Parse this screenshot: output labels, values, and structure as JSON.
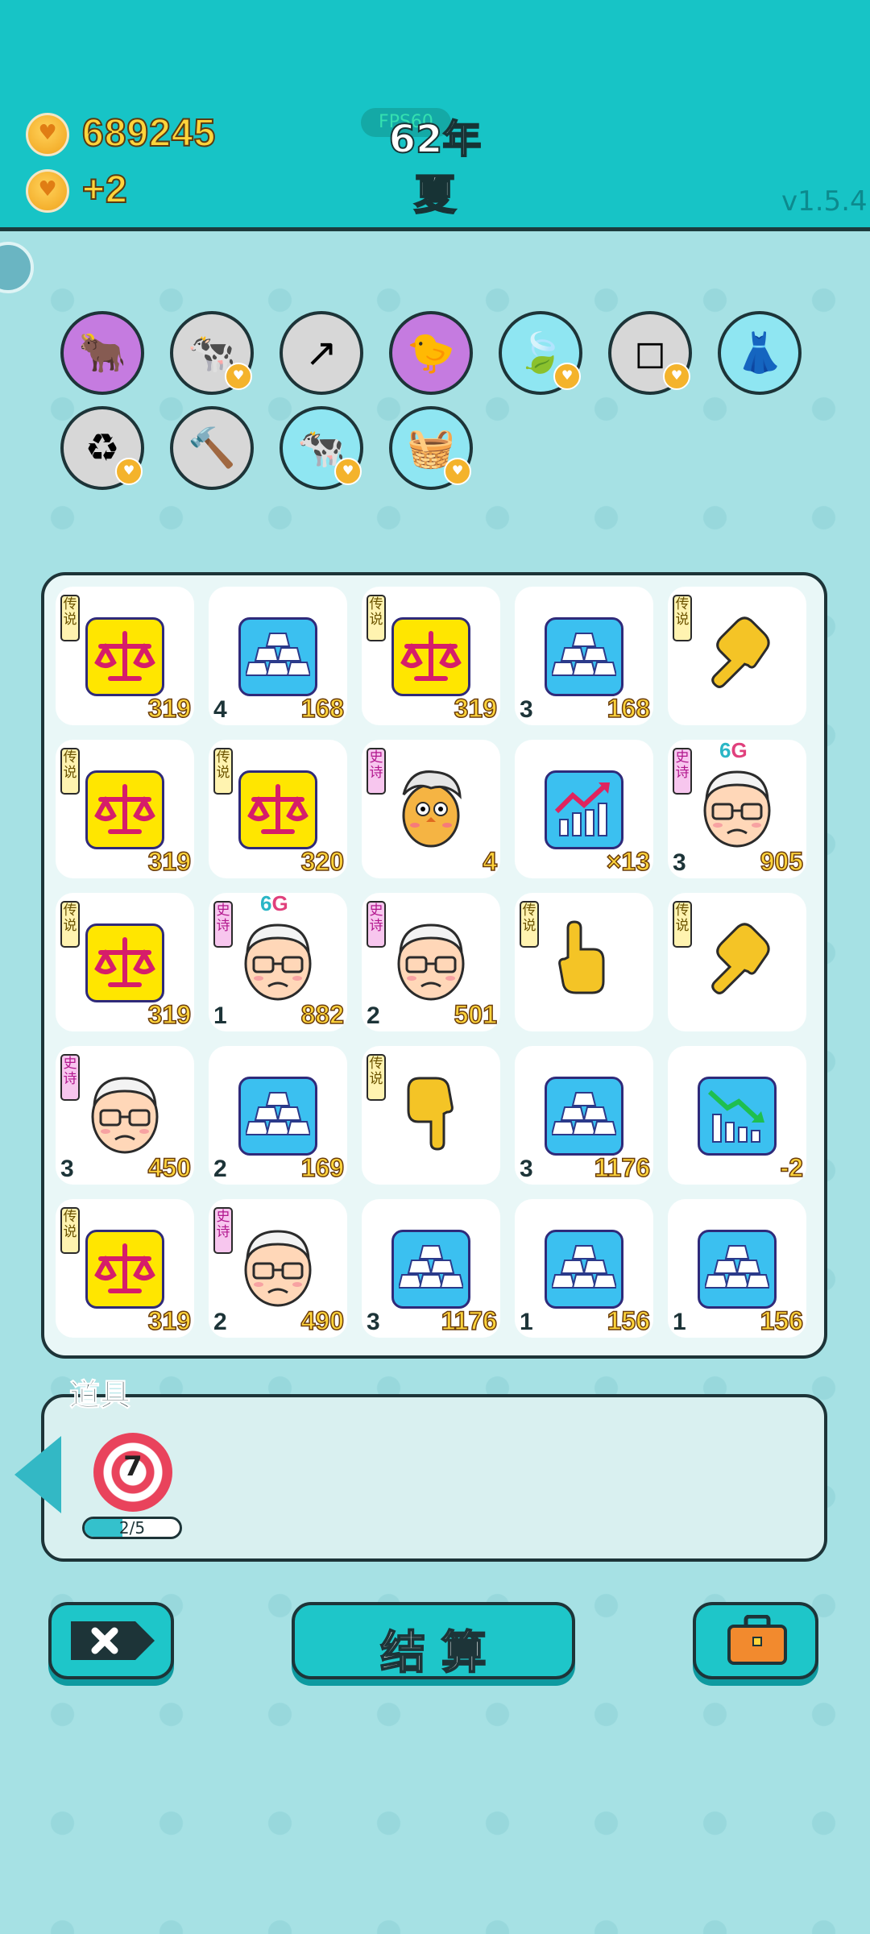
{
  "header": {
    "coins": "689245",
    "income": "+2",
    "fps": "FPS60",
    "year": "62年",
    "season": "夏",
    "version": "v1.5.4"
  },
  "buffs": [
    {
      "name": "bull-cube-icon",
      "glyph": "🐂",
      "bg": "#c57be0",
      "heart": false
    },
    {
      "name": "cows-icon",
      "glyph": "🐄",
      "bg": "#d7d7d7",
      "heart": true
    },
    {
      "name": "arrow-up-icon",
      "glyph": "↗",
      "bg": "#d7d7d7",
      "heart": false
    },
    {
      "name": "chick-egg-icon",
      "glyph": "🐤",
      "bg": "#c57be0",
      "heart": false
    },
    {
      "name": "leaf-icon",
      "glyph": "🍃",
      "bg": "#8fe6f2",
      "heart": true
    },
    {
      "name": "blocks-icon",
      "glyph": "◻",
      "bg": "#d7d7d7",
      "heart": true
    },
    {
      "name": "skirt-icon",
      "glyph": "👗",
      "bg": "#8fe6f2",
      "heart": false
    },
    {
      "name": "recycle-icon",
      "glyph": "♻",
      "bg": "#d7d7d7",
      "heart": true
    },
    {
      "name": "hammer-icon",
      "glyph": "🔨",
      "bg": "#d7d7d7",
      "heart": false
    },
    {
      "name": "cows-blue-icon",
      "glyph": "🐄",
      "bg": "#8fe6f2",
      "heart": true
    },
    {
      "name": "fruit-basket-icon",
      "glyph": "🧺",
      "bg": "#8fe6f2",
      "heart": true
    }
  ],
  "board": [
    [
      {
        "type": "scale",
        "tag": "传说",
        "tagType": "leg",
        "left": "",
        "right": "319"
      },
      {
        "type": "gold",
        "tag": "",
        "left": "4",
        "right": "168"
      },
      {
        "type": "scale",
        "tag": "传说",
        "tagType": "leg",
        "left": "",
        "right": "319"
      },
      {
        "type": "gold",
        "tag": "",
        "left": "3",
        "right": "168"
      },
      {
        "type": "point-down-left",
        "tag": "传说",
        "tagType": "leg",
        "left": "",
        "right": ""
      }
    ],
    [
      {
        "type": "scale",
        "tag": "传说",
        "tagType": "leg",
        "left": "",
        "right": "319"
      },
      {
        "type": "scale",
        "tag": "传说",
        "tagType": "leg",
        "left": "",
        "right": "320"
      },
      {
        "type": "chick",
        "tag": "史诗",
        "tagType": "epic",
        "left": "",
        "right": "4"
      },
      {
        "type": "stock-up",
        "tag": "",
        "left": "",
        "right": "×13"
      },
      {
        "type": "oldman",
        "tag": "史诗",
        "tagType": "epic",
        "left": "3",
        "right": "905",
        "g": "6G"
      }
    ],
    [
      {
        "type": "scale",
        "tag": "传说",
        "tagType": "leg",
        "left": "",
        "right": "319"
      },
      {
        "type": "oldman",
        "tag": "史诗",
        "tagType": "epic",
        "left": "1",
        "right": "882",
        "g": "6G"
      },
      {
        "type": "oldman",
        "tag": "史诗",
        "tagType": "epic",
        "left": "2",
        "right": "501"
      },
      {
        "type": "point-up",
        "tag": "传说",
        "tagType": "leg",
        "left": "",
        "right": ""
      },
      {
        "type": "point-down-left",
        "tag": "传说",
        "tagType": "leg",
        "left": "",
        "right": ""
      }
    ],
    [
      {
        "type": "oldman",
        "tag": "史诗",
        "tagType": "epic",
        "left": "3",
        "right": "450"
      },
      {
        "type": "gold",
        "tag": "",
        "left": "2",
        "right": "169"
      },
      {
        "type": "point-down",
        "tag": "传说",
        "tagType": "leg",
        "left": "",
        "right": ""
      },
      {
        "type": "gold",
        "tag": "",
        "left": "3",
        "right": "1176"
      },
      {
        "type": "stock-down",
        "tag": "",
        "left": "",
        "right": "-2"
      }
    ],
    [
      {
        "type": "scale",
        "tag": "传说",
        "tagType": "leg",
        "left": "",
        "right": "319"
      },
      {
        "type": "oldman",
        "tag": "史诗",
        "tagType": "epic",
        "left": "2",
        "right": "490"
      },
      {
        "type": "gold",
        "tag": "",
        "left": "3",
        "right": "1176"
      },
      {
        "type": "gold",
        "tag": "",
        "left": "1",
        "right": "156"
      },
      {
        "type": "gold",
        "tag": "",
        "left": "1",
        "right": "156"
      }
    ]
  ],
  "items": {
    "label": "道具",
    "target_count": "7",
    "progress_text": "2/5",
    "progress": 0.4
  },
  "buttons": {
    "settle": "结 算"
  }
}
